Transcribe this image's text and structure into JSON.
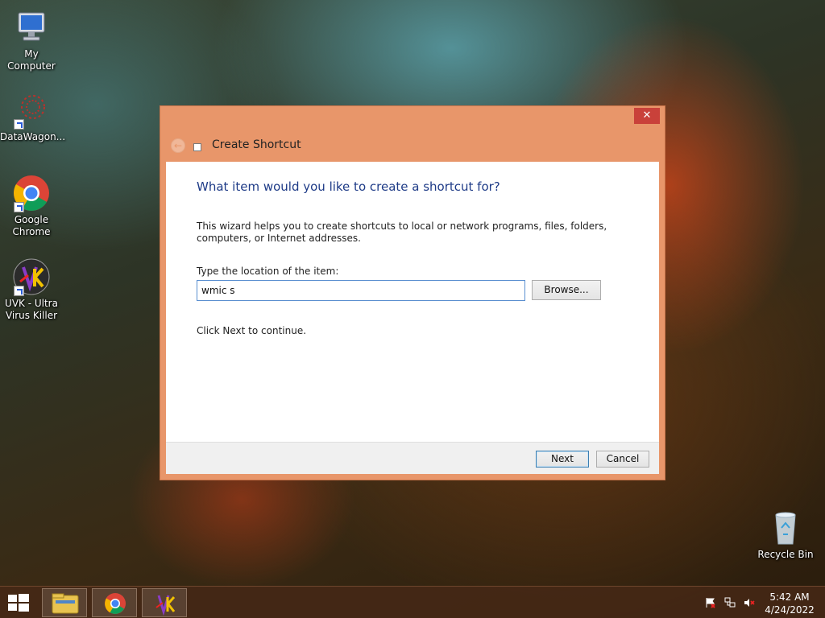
{
  "desktop": {
    "icons": [
      {
        "label": "My Computer",
        "icon": "computer-icon"
      },
      {
        "label": "DataWagon...",
        "icon": "datawagon-icon"
      },
      {
        "label": "Google Chrome",
        "icon": "chrome-icon"
      },
      {
        "label": "UVK - Ultra Virus Killer",
        "icon": "uvk-icon"
      },
      {
        "label": "Recycle Bin",
        "icon": "recycle-bin-icon"
      }
    ]
  },
  "dialog": {
    "title": "Create Shortcut",
    "close_label": "✕",
    "back_label": "←",
    "heading": "What item would you like to create a shortcut for?",
    "description": "This wizard helps you to create shortcuts to local or network programs, files, folders, computers, or Internet addresses.",
    "location_label": "Type the location of the item:",
    "location_value": "wmic s",
    "browse_label": "Browse...",
    "continue_text": "Click Next to continue.",
    "next_label": "Next",
    "cancel_label": "Cancel"
  },
  "taskbar": {
    "pinned": [
      {
        "icon": "file-explorer-icon"
      },
      {
        "icon": "chrome-icon"
      },
      {
        "icon": "uvk-icon"
      }
    ],
    "tray_icons": [
      "action-center-flag-icon",
      "network-icon",
      "volume-muted-icon"
    ],
    "time": "5:42 AM",
    "date": "4/24/2022"
  },
  "colors": {
    "dialog_frame": "#e8966a",
    "heading_text": "#1e3b87",
    "close_button": "#c9413a"
  }
}
